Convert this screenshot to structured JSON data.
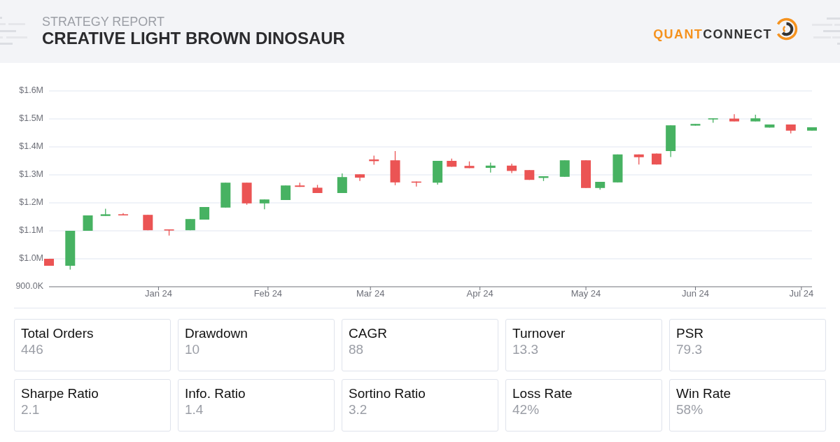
{
  "header": {
    "subtitle": "STRATEGY REPORT",
    "title": "CREATIVE LIGHT BROWN DINOSAUR",
    "logo": [
      "QUANT",
      "CONNECT"
    ]
  },
  "chart": {
    "chart_data": {
      "type": "candlestick",
      "x": [
        "2023-12-01",
        "2023-12-07",
        "2023-12-12",
        "2023-12-17",
        "2023-12-22",
        "2023-12-29",
        "2024-01-04",
        "2024-01-10",
        "2024-01-14",
        "2024-01-20",
        "2024-01-26",
        "2024-01-31",
        "2024-02-06",
        "2024-02-10",
        "2024-02-15",
        "2024-02-22",
        "2024-02-27",
        "2024-03-02",
        "2024-03-08",
        "2024-03-14",
        "2024-03-20",
        "2024-03-24",
        "2024-03-29",
        "2024-04-04",
        "2024-04-10",
        "2024-04-15",
        "2024-04-19",
        "2024-04-25",
        "2024-05-01",
        "2024-05-05",
        "2024-05-10",
        "2024-05-16",
        "2024-05-21",
        "2024-05-25",
        "2024-06-01",
        "2024-06-06",
        "2024-06-12",
        "2024-06-18",
        "2024-06-22",
        "2024-06-28",
        "2024-07-04"
      ],
      "ohlc": [
        [
          1000000,
          1000000,
          975000,
          975000
        ],
        [
          975000,
          1100000,
          961000,
          1100000
        ],
        [
          1100000,
          1155000,
          1100000,
          1155000
        ],
        [
          1153000,
          1179000,
          1153000,
          1159000
        ],
        [
          1159000,
          1163000,
          1155000,
          1155000
        ],
        [
          1157000,
          1157000,
          1102000,
          1102000
        ],
        [
          1105000,
          1105000,
          1083000,
          1102000
        ],
        [
          1102000,
          1142000,
          1102000,
          1142000
        ],
        [
          1140000,
          1185000,
          1140000,
          1185000
        ],
        [
          1183000,
          1272000,
          1183000,
          1272000
        ],
        [
          1272000,
          1272000,
          1193000,
          1198000
        ],
        [
          1198000,
          1212000,
          1177000,
          1212000
        ],
        [
          1210000,
          1262000,
          1210000,
          1262000
        ],
        [
          1262000,
          1272000,
          1257000,
          1257000
        ],
        [
          1254000,
          1264000,
          1235000,
          1235000
        ],
        [
          1235000,
          1305000,
          1235000,
          1292000
        ],
        [
          1302000,
          1302000,
          1278000,
          1290000
        ],
        [
          1355000,
          1369000,
          1336000,
          1349000
        ],
        [
          1352000,
          1385000,
          1263000,
          1273000
        ],
        [
          1276000,
          1276000,
          1258000,
          1272000
        ],
        [
          1272000,
          1350000,
          1265000,
          1350000
        ],
        [
          1350000,
          1358000,
          1329000,
          1329000
        ],
        [
          1332000,
          1348000,
          1324000,
          1324000
        ],
        [
          1325000,
          1344000,
          1308000,
          1333000
        ],
        [
          1333000,
          1340000,
          1306000,
          1314000
        ],
        [
          1317000,
          1317000,
          1282000,
          1282000
        ],
        [
          1289000,
          1295000,
          1278000,
          1295000
        ],
        [
          1293000,
          1352000,
          1293000,
          1352000
        ],
        [
          1352000,
          1352000,
          1253000,
          1253000
        ],
        [
          1253000,
          1275000,
          1247000,
          1275000
        ],
        [
          1273000,
          1373000,
          1273000,
          1373000
        ],
        [
          1373000,
          1373000,
          1337000,
          1363000
        ],
        [
          1376000,
          1376000,
          1337000,
          1337000
        ],
        [
          1385000,
          1477000,
          1364000,
          1477000
        ],
        [
          1476000,
          1482000,
          1476000,
          1482000
        ],
        [
          1498000,
          1502000,
          1486000,
          1502000
        ],
        [
          1501000,
          1517000,
          1491000,
          1491000
        ],
        [
          1491000,
          1515000,
          1491000,
          1502000
        ],
        [
          1469000,
          1480000,
          1469000,
          1480000
        ],
        [
          1480000,
          1480000,
          1448000,
          1458000
        ],
        [
          1458000,
          1470000,
          1458000,
          1470000
        ]
      ],
      "xlim": [
        "2023-12-01",
        "2024-07-04"
      ],
      "ylim": [
        900000,
        1600000
      ],
      "grid": true,
      "xticks": [
        {
          "value": "2024-01-01",
          "label": "Jan 24"
        },
        {
          "value": "2024-02-01",
          "label": "Feb 24"
        },
        {
          "value": "2024-03-01",
          "label": "Mar 24"
        },
        {
          "value": "2024-04-01",
          "label": "Apr 24"
        },
        {
          "value": "2024-05-01",
          "label": "May 24"
        },
        {
          "value": "2024-06-01",
          "label": "Jun 24"
        },
        {
          "value": "2024-07-01",
          "label": "Jul 24"
        }
      ],
      "yticks": [
        {
          "value": 900000,
          "label": "900.0K"
        },
        {
          "value": 1000000,
          "label": "$1.0M"
        },
        {
          "value": 1100000,
          "label": "$1.1M"
        },
        {
          "value": 1200000,
          "label": "$1.2M"
        },
        {
          "value": 1300000,
          "label": "$1.3M"
        },
        {
          "value": 1400000,
          "label": "$1.4M"
        },
        {
          "value": 1500000,
          "label": "$1.5M"
        },
        {
          "value": 1600000,
          "label": "$1.6M"
        }
      ]
    }
  },
  "stats": [
    {
      "label": "Total Orders",
      "value": "446"
    },
    {
      "label": "Drawdown",
      "value": "10"
    },
    {
      "label": "CAGR",
      "value": "88"
    },
    {
      "label": "Turnover",
      "value": "13.3"
    },
    {
      "label": "PSR",
      "value": "79.3"
    },
    {
      "label": "Sharpe Ratio",
      "value": "2.1"
    },
    {
      "label": "Info. Ratio",
      "value": "1.4"
    },
    {
      "label": "Sortino Ratio",
      "value": "3.2"
    },
    {
      "label": "Loss Rate",
      "value": "42%"
    },
    {
      "label": "Win Rate",
      "value": "58%"
    }
  ]
}
